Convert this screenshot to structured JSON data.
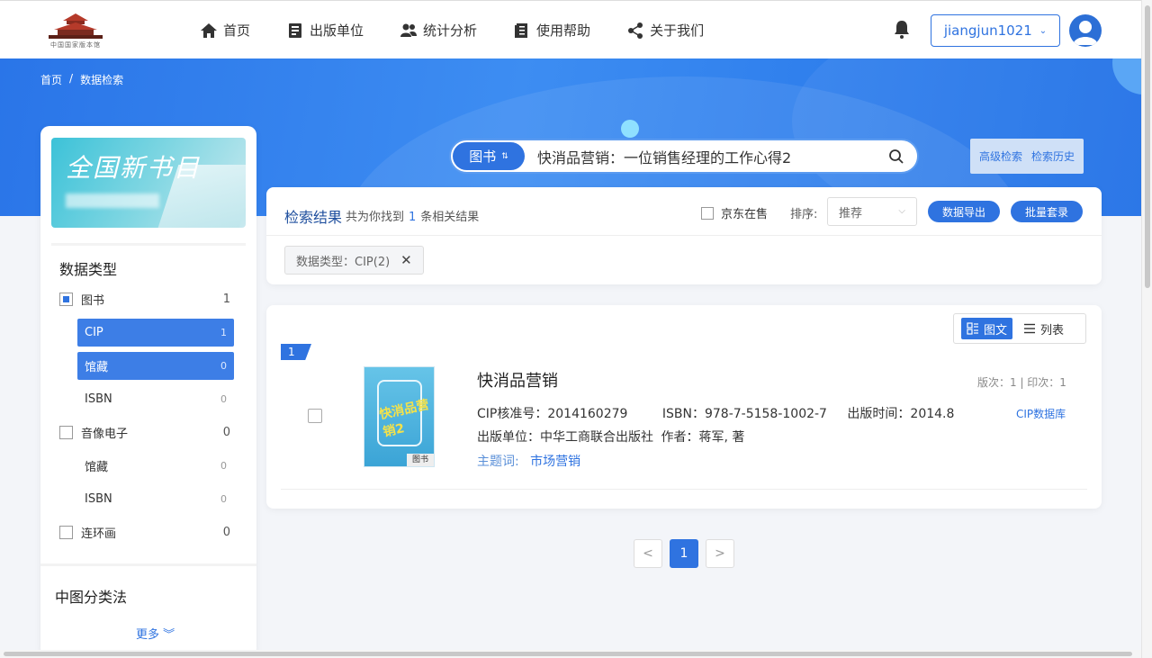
{
  "header": {
    "logo_text": "中国国家版本馆",
    "nav": [
      {
        "label": "首页",
        "icon": "home-icon"
      },
      {
        "label": "出版单位",
        "icon": "book-icon"
      },
      {
        "label": "统计分析",
        "icon": "users-icon"
      },
      {
        "label": "使用帮助",
        "icon": "document-icon"
      },
      {
        "label": "关于我们",
        "icon": "share-icon"
      }
    ],
    "username": "jiangjun1021"
  },
  "breadcrumb": {
    "home": "首页",
    "sep": "/",
    "current": "数据检索"
  },
  "search": {
    "type_label": "图书",
    "query": "快消品营销：一位销售经理的工作心得2",
    "advanced": "高级检索",
    "history": "检索历史"
  },
  "sidebar": {
    "banner_text": "全国新书目",
    "type_title": "数据类型",
    "types": [
      {
        "label": "图书",
        "count": "1",
        "checked": true,
        "children": [
          {
            "label": "CIP",
            "count": "1",
            "active": true
          },
          {
            "label": "馆藏",
            "count": "0",
            "active": true
          },
          {
            "label": "ISBN",
            "count": "0",
            "active": false
          }
        ]
      },
      {
        "label": "音像电子",
        "count": "0",
        "checked": false,
        "children": [
          {
            "label": "馆藏",
            "count": "0",
            "active": false
          },
          {
            "label": "ISBN",
            "count": "0",
            "active": false
          }
        ]
      },
      {
        "label": "连环画",
        "count": "0",
        "checked": false,
        "children": []
      }
    ],
    "classification_title": "中图分类法",
    "more": "更多"
  },
  "results": {
    "title": "检索结果",
    "summary_prefix": "共为你找到",
    "count": "1",
    "summary_suffix": "条相关结果",
    "jd_label": "京东在售",
    "sort_label": "排序:",
    "sort_value": "推荐",
    "export_btn": "数据导出",
    "batch_btn": "批量套录",
    "filter_tag": "数据类型：CIP(2)"
  },
  "view": {
    "grid": "图文",
    "list": "列表"
  },
  "item": {
    "index": "1",
    "title": "快消品营销",
    "edition": "版次：1 | 印次：1",
    "cip": "CIP核准号：2014160279",
    "isbn": "ISBN：978-7-5158-1002-7",
    "pubdate": "出版时间：2014.8",
    "publisher": "出版单位：中华工商联合出版社",
    "author": "作者：蒋军, 著",
    "subject_key": "主题词:",
    "subject_val": "市场营销",
    "source": "CIP数据库",
    "cover_badge": "图书",
    "cover_title": "快消品营销",
    "cover_number": "2"
  },
  "pagination": {
    "prev": "<",
    "current": "1",
    "next": ">"
  },
  "colors": {
    "primary": "#2f73e0",
    "banner": "#3d8df2"
  }
}
